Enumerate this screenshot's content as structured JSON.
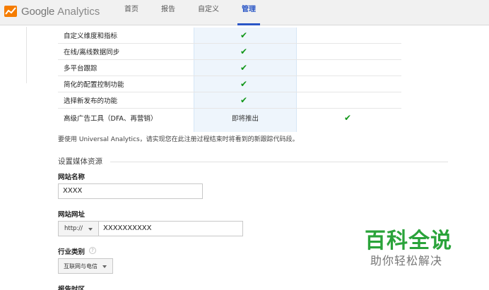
{
  "header": {
    "logo_google": "Google",
    "logo_analytics": "Analytics",
    "nav": [
      {
        "label": "首页",
        "active": false
      },
      {
        "label": "报告",
        "active": false
      },
      {
        "label": "自定义",
        "active": false
      },
      {
        "label": "管理",
        "active": true
      }
    ]
  },
  "features": {
    "rows": [
      {
        "label": "自定义维度和指标",
        "col1": "✔",
        "col2": ""
      },
      {
        "label": "在线/离线数据同步",
        "col1": "✔",
        "col2": ""
      },
      {
        "label": "多平台跟踪",
        "col1": "✔",
        "col2": ""
      },
      {
        "label": "简化的配置控制功能",
        "col1": "✔",
        "col2": ""
      },
      {
        "label": "选择新发布的功能",
        "col1": "✔",
        "col2": ""
      },
      {
        "label": "高级广告工具（DFA、再营销）",
        "col1": "即将推出",
        "col2": "✔"
      }
    ],
    "note": "要使用 Universal Analytics，请实现您在此注册过程结束时将看到的新跟踪代码段。"
  },
  "form": {
    "section_title": "设置媒体资源",
    "site_name_label": "网站名称",
    "site_name_value": "XXXX",
    "site_url_label": "网站网址",
    "protocol_value": "http://",
    "site_url_value": "XXXXXXXXXX",
    "industry_label": "行业类别",
    "industry_value": "互联网与电信",
    "timezone_label": "报告时区"
  },
  "watermark": {
    "title": "百科全说",
    "subtitle": "助你轻松解决"
  },
  "colors": {
    "accent": "#2a56c6",
    "check": "#109618",
    "watermark": "#2aa33a"
  }
}
